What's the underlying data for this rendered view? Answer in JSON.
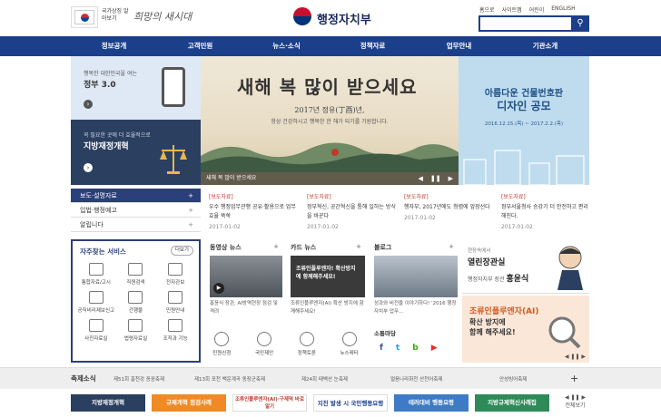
{
  "header": {
    "flag_label": "국가상징 알아보기",
    "slogan": "희망의 새시대",
    "logo_text": "행정자치부",
    "top_links": [
      "홈으로",
      "사이트맵",
      "어린이",
      "ENGLISH"
    ],
    "search_placeholder": ""
  },
  "gnb": [
    "정보공개",
    "고객민원",
    "뉴스·소식",
    "정책자료",
    "업무안내",
    "기관소개"
  ],
  "banner_left_top": {
    "line1": "행복한 대한민국을 여는",
    "line2": "정부 3.0"
  },
  "banner_left_bottom": {
    "line1": "꼭 필요한 곳에 더 효율적으로",
    "line2": "지방재정개혁"
  },
  "main_banner": {
    "title": "새해 복 많이 받으세요",
    "subtitle": "2017년 정유(丁酉)년,",
    "desc": "항상 건강하시고 행복한 한 해가 되기를 기원합니다.",
    "caption": "새해 복 많이 받으세요",
    "controls": [
      "◀",
      "❚❚",
      "▶"
    ]
  },
  "banner_right": {
    "line1": "아름다운 건물번호판",
    "line2": "디자인 공모",
    "period": "2016.12.15.(목) ~ 2017.2.2.(목)"
  },
  "news_nav": [
    {
      "label": "보도·설명자료",
      "plus": "+"
    },
    {
      "label": "입법·행정예고",
      "plus": "+"
    },
    {
      "label": "알립니다",
      "plus": "+"
    }
  ],
  "news_items": [
    {
      "tag": "[보도자료]",
      "title": "우수 행정업무관행 공유·활용으로 업무효율 쑥쑥",
      "date": "2017-01-02"
    },
    {
      "tag": "[보도자료]",
      "title": "정부혁신, 공간혁신을 통해 일하는 방식을 바꾼다",
      "date": "2017-01-02"
    },
    {
      "tag": "[보도자료]",
      "title": "행자부, 2017년에도 청렴에 앞장선다",
      "date": "2017-01-02"
    },
    {
      "tag": "[보도자료]",
      "title": "정부서울청사 승강기 더 안전하고 편리해진다.",
      "date": "2017-01-02"
    }
  ],
  "services": {
    "title": "자주찾는 서비스",
    "more": "더보기",
    "items": [
      "통합자료/고시",
      "직원검색",
      "전자관보",
      "공직비리제보신고",
      "간행물",
      "민원안내",
      "사진자료실",
      "법령자료실",
      "조직과 기능"
    ]
  },
  "video": {
    "title": "동영상 뉴스",
    "plus": "+",
    "caption": "홍윤식 장관, AI방역현장 점검 및 격려"
  },
  "cardnews": {
    "title": "카드 뉴스",
    "plus": "+",
    "overlay": "조류인플루엔자! 확산방지에 함께해주세요!",
    "caption": "조류인플루엔자(AI) 확산 방지에 함께해주세요!"
  },
  "blog": {
    "title": "블로그",
    "plus": "+",
    "caption": "성과와 비전을 이야기하다! '2016 행정자치부 업무..."
  },
  "quick_icons": [
    "민원신청",
    "국민제안",
    "정책토론",
    "뉴스레터"
  ],
  "social": {
    "title": "소통마당",
    "icons": [
      "f",
      "t",
      "b",
      "▶"
    ]
  },
  "minister": {
    "line1": "현장속에서",
    "line2": "열린장관실",
    "line3": "행정자치부 장관",
    "name": "홍윤식"
  },
  "avian": {
    "line1": "조류인플루엔자(AI)",
    "line2": "확산 방지에",
    "line3": "함께 해주세요!",
    "controls": "◀ ❚❚ ▶"
  },
  "festival": {
    "title": "축제소식",
    "items": [
      "제51회 홍천강 꽁꽁축제",
      "제13회 포천 백운계곡 동장군축제",
      "제24회 태백산 눈축제",
      "얼음나라화천 산천어축제",
      "안성빙어축제"
    ],
    "plus": "+"
  },
  "bottom_banners": [
    "지방재정개혁",
    "규제개혁 점검사례",
    "조류인플루엔자(AI)·구제역 바로 알기",
    "지진 발생 시 국민행동요령",
    "테러대비 행동요령",
    "지방규제혁신사례집"
  ],
  "pager": {
    "arrows": "◀ ❚❚ ▶",
    "label": "전체보기"
  },
  "colors": {
    "navy": "#1c3f8c",
    "accent_red": "#c0392b",
    "avian_orange": "#d45a1f"
  }
}
